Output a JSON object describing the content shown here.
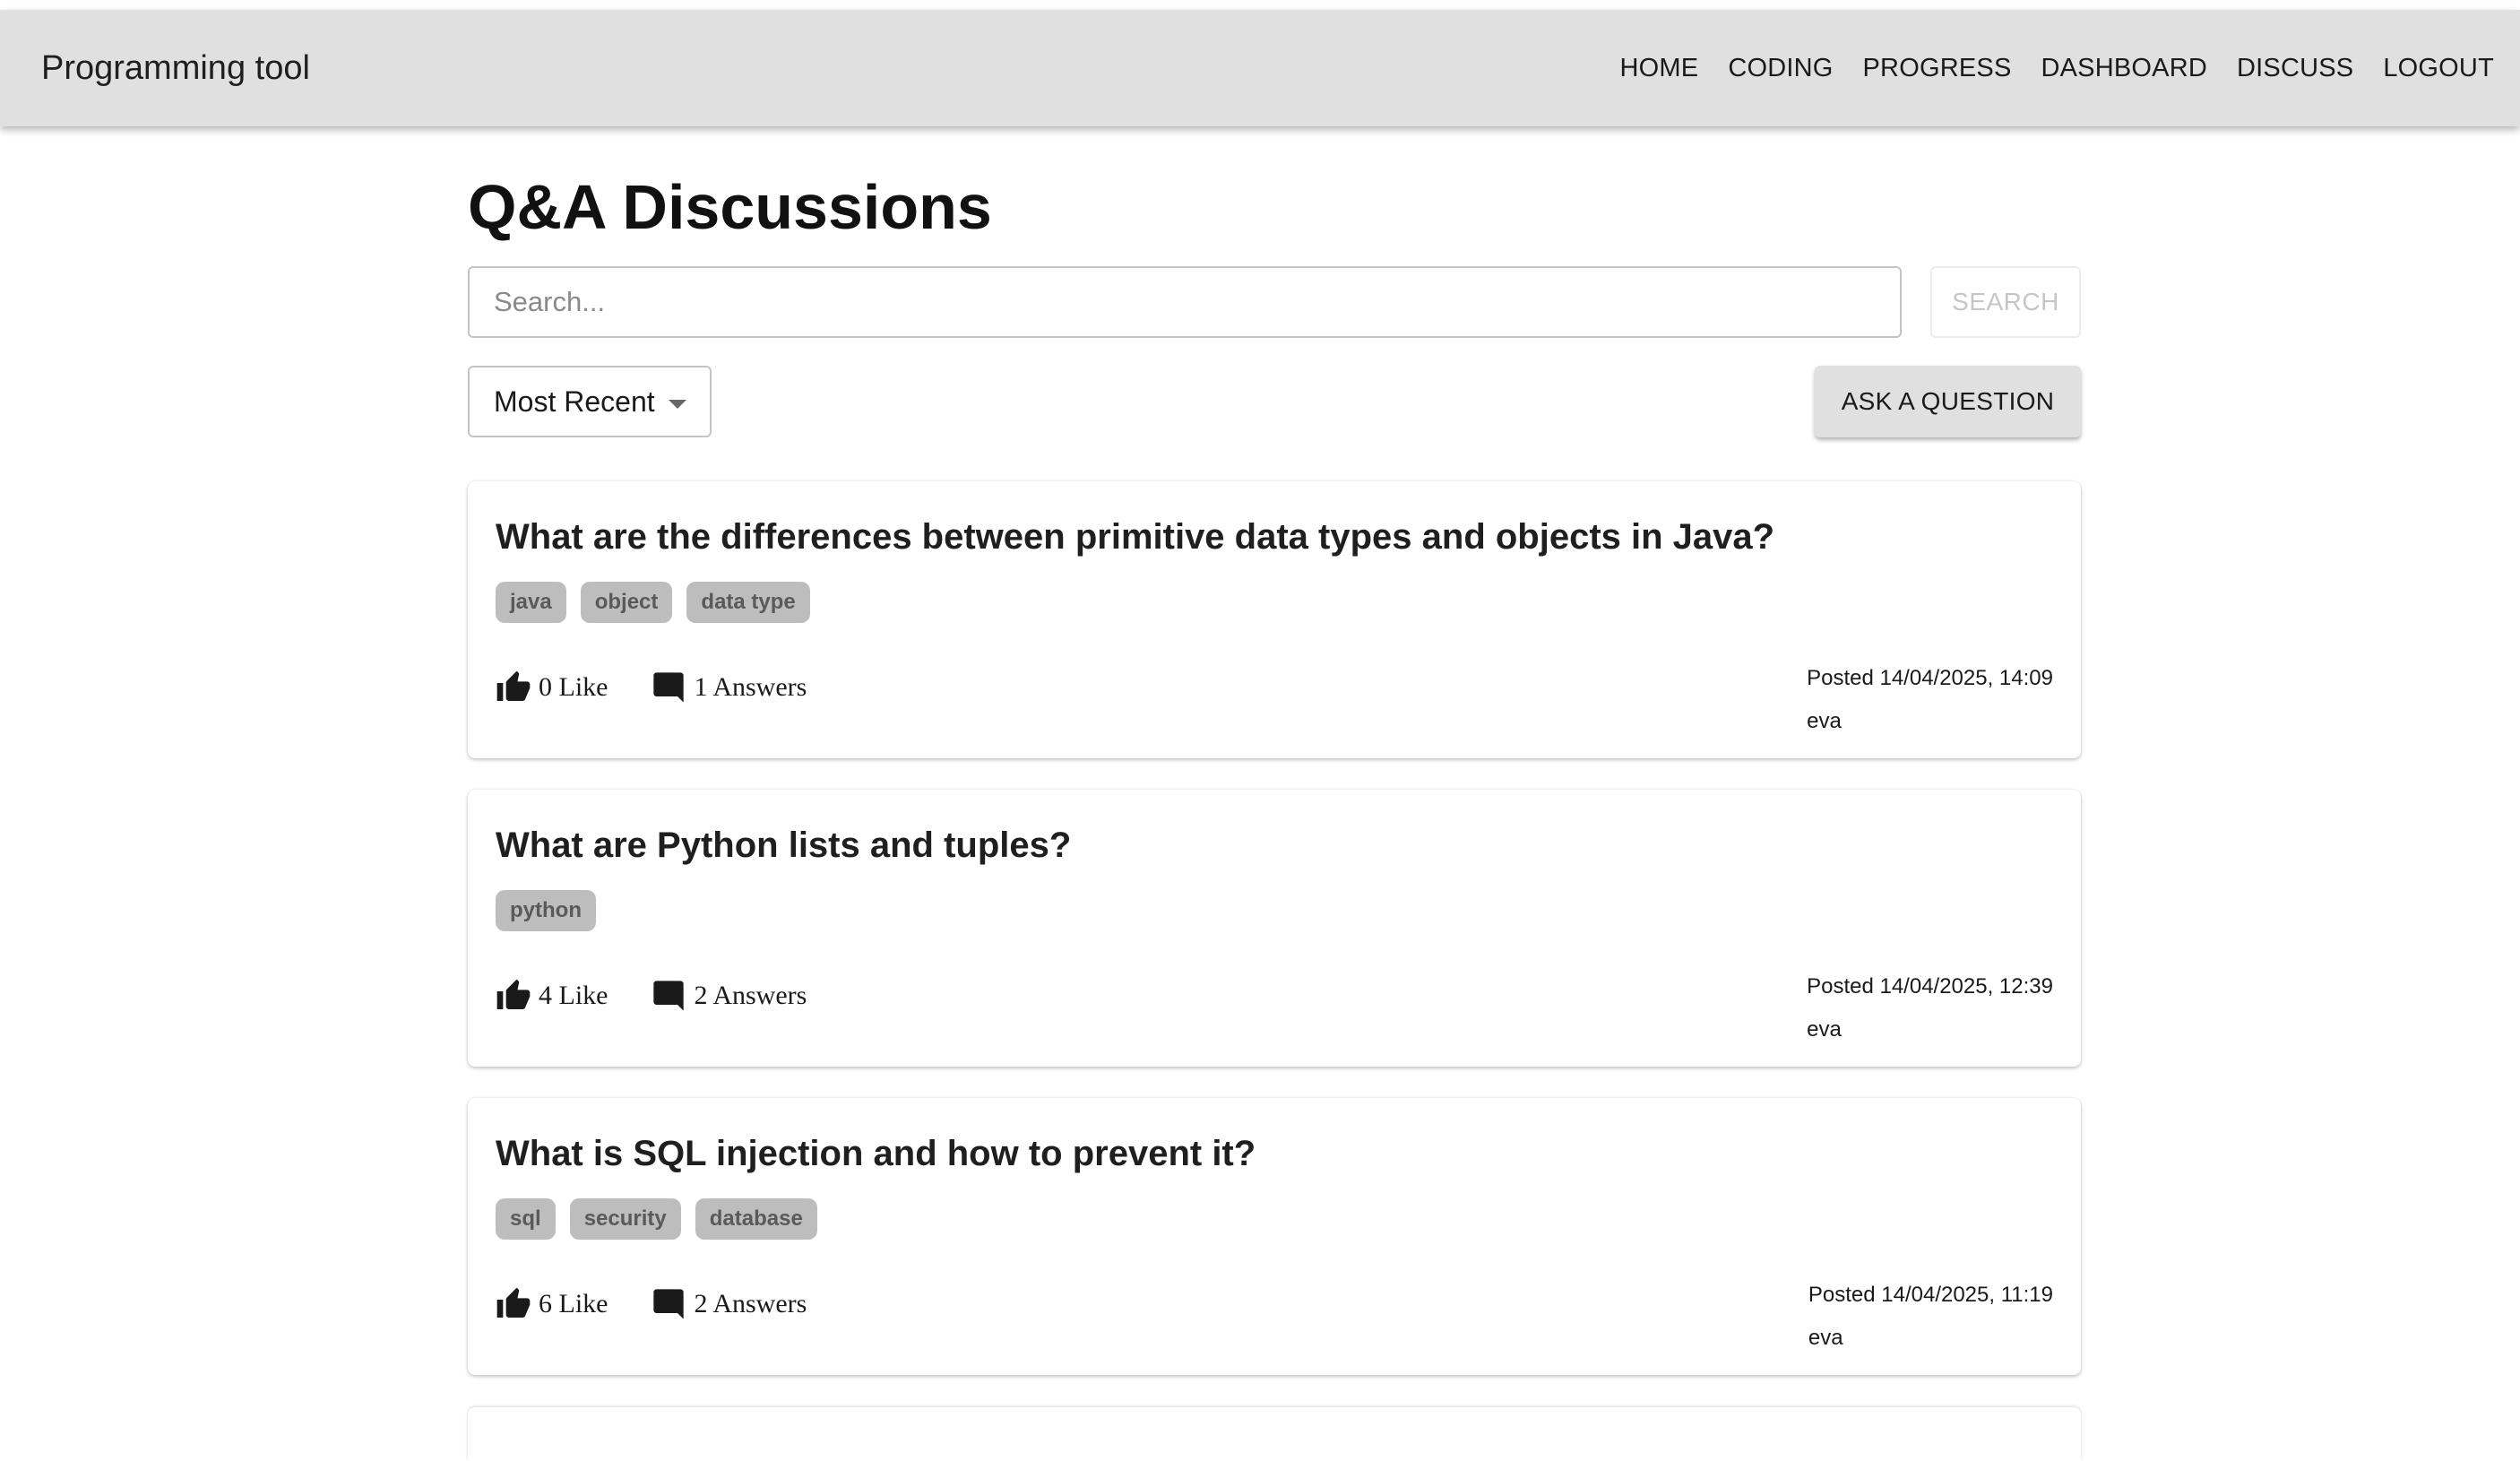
{
  "app": {
    "title": "Programming tool"
  },
  "nav": [
    {
      "label": "HOME"
    },
    {
      "label": "CODING"
    },
    {
      "label": "PROGRESS"
    },
    {
      "label": "DASHBOARD"
    },
    {
      "label": "DISCUSS"
    },
    {
      "label": "LOGOUT"
    }
  ],
  "page": {
    "title": "Q&A Discussions"
  },
  "search": {
    "placeholder": "Search...",
    "value": "",
    "button_label": "SEARCH"
  },
  "sort": {
    "selected": "Most Recent"
  },
  "ask_button_label": "ASK A QUESTION",
  "questions": [
    {
      "title": "What are the differences between primitive data types and objects in Java?",
      "tags": [
        "java",
        "object",
        "data type"
      ],
      "likes": "0 Like",
      "answers": "1 Answers",
      "posted": "Posted 14/04/2025, 14:09",
      "author": "eva"
    },
    {
      "title": "What are Python lists and tuples?",
      "tags": [
        "python"
      ],
      "likes": "4 Like",
      "answers": "2 Answers",
      "posted": "Posted 14/04/2025, 12:39",
      "author": "eva"
    },
    {
      "title": "What is SQL injection and how to prevent it?",
      "tags": [
        "sql",
        "security",
        "database"
      ],
      "likes": "6 Like",
      "answers": "2 Answers",
      "posted": "Posted 14/04/2025, 11:19",
      "author": "eva"
    }
  ],
  "icons": {
    "like": "thumb-up-icon",
    "answers": "comment-icon",
    "sort": "caret-down-icon"
  },
  "colors": {
    "appbar": "#e0e0e0",
    "tag_bg": "#bdbdbd",
    "tag_text": "#5a5a5a"
  }
}
